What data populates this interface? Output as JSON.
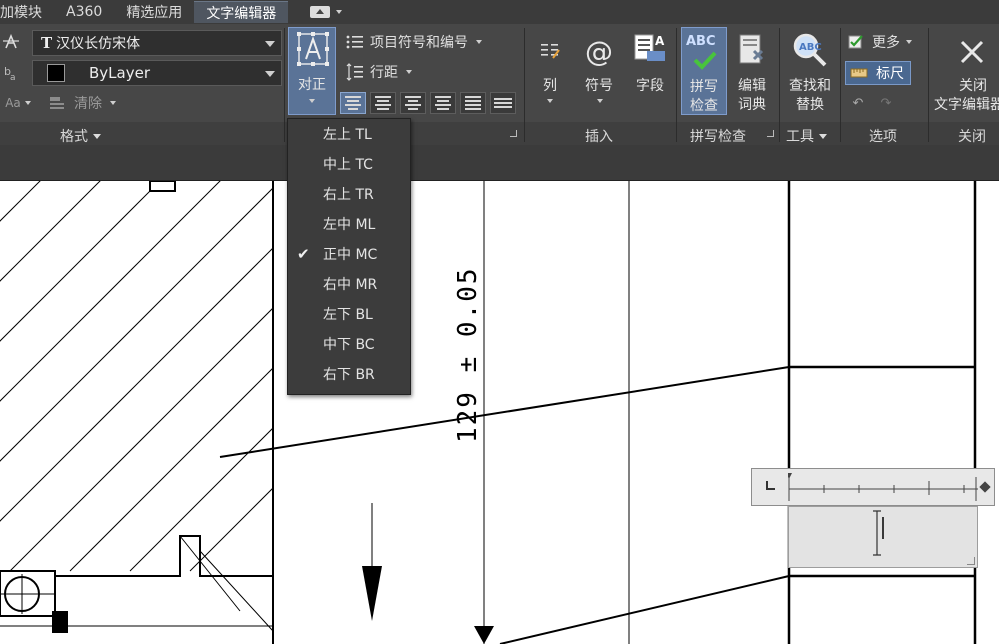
{
  "tabs": [
    {
      "label": "加模块",
      "active": false
    },
    {
      "label": "A360",
      "active": false
    },
    {
      "label": "精选应用",
      "active": false
    },
    {
      "label": "文字编辑器",
      "active": true
    }
  ],
  "format": {
    "font_value": "汉仪长仿宋体",
    "color_value": "ByLayer",
    "clear_label": "清除",
    "panel_label": "格式"
  },
  "paragraph": {
    "justify_label": "对正",
    "bullets_label": "项目符号和编号",
    "line_spacing_label": "行距"
  },
  "insert": {
    "columns_label": "列",
    "symbol_label": "符号",
    "field_label": "字段",
    "panel_label": "插入"
  },
  "spell": {
    "abc": "ABC",
    "spell_check_line1": "拼写",
    "spell_check_line2": "检查",
    "edit_dict_line1": "编辑",
    "edit_dict_line2": "词典",
    "panel_label": "拼写检查"
  },
  "tools": {
    "find_replace_line1": "查找和",
    "find_replace_line2": "替换",
    "panel_label": "工具"
  },
  "options": {
    "more_label": "更多",
    "ruler_label": "标尺",
    "panel_label": "选项"
  },
  "close": {
    "close_line1": "关闭",
    "close_line2": "文字编辑器",
    "panel_label": "关闭"
  },
  "justify_menu": [
    {
      "label": "左上 TL",
      "checked": false
    },
    {
      "label": "中上 TC",
      "checked": false
    },
    {
      "label": "右上 TR",
      "checked": false
    },
    {
      "label": "左中 ML",
      "checked": false
    },
    {
      "label": "正中 MC",
      "checked": true
    },
    {
      "label": "右中 MR",
      "checked": false
    },
    {
      "label": "左下 BL",
      "checked": false
    },
    {
      "label": "中下 BC",
      "checked": false
    },
    {
      "label": "右下 BR",
      "checked": false
    }
  ],
  "drawing": {
    "dimension_text": "129 ± 0.05"
  },
  "colors": {
    "ribbon_bg": "#474747",
    "active_blue": "#5a7397",
    "dropdown_bg": "#3c3c3c"
  }
}
